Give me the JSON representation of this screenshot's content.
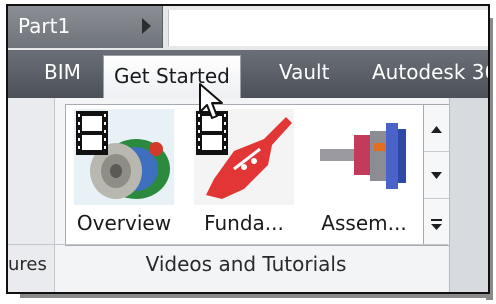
{
  "document": {
    "name": "Part1"
  },
  "tabs": [
    "BIM",
    "Get Started",
    "Vault",
    "Autodesk 36"
  ],
  "active_tab": "Get Started",
  "left_panel": {
    "label": "ures"
  },
  "panel": {
    "title": "Videos and Tutorials",
    "items": [
      {
        "label": "Overview",
        "icon": "film-gear-icon"
      },
      {
        "label": "Funda...",
        "icon": "film-guitar-icon"
      },
      {
        "label": "Assem...",
        "icon": "assembly-icon"
      }
    ]
  },
  "colors": {
    "tabbar": "#5b5f67",
    "active_tab": "#ffffff",
    "ribbon": "#eff1f4"
  }
}
